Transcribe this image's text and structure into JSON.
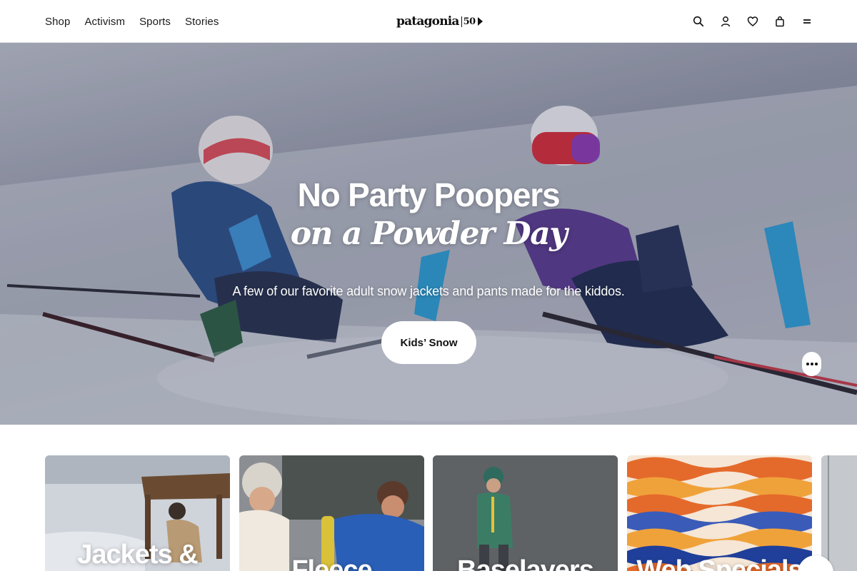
{
  "header": {
    "nav": [
      "Shop",
      "Activism",
      "Sports",
      "Stories"
    ],
    "logo_text": "patagonia",
    "logo_badge": "50",
    "icons": [
      "search-icon",
      "account-icon",
      "wishlist-heart-icon",
      "bag-icon",
      "menu-icon"
    ]
  },
  "hero": {
    "title_line1": "No Party Poopers",
    "title_line2": "on a Powder Day",
    "subtitle": "A few of our favorite adult snow jackets and pants made for the kiddos.",
    "cta_label": "Kids’ Snow",
    "more_label": "•••"
  },
  "cards": [
    {
      "label": "Jackets &"
    },
    {
      "label": "Fleece"
    },
    {
      "label": "Baselayers"
    },
    {
      "label": "Web Specials"
    }
  ],
  "colors": {
    "hero_text": "#ffffff",
    "cta_bg": "#ffffff",
    "text_dark": "#111111"
  }
}
